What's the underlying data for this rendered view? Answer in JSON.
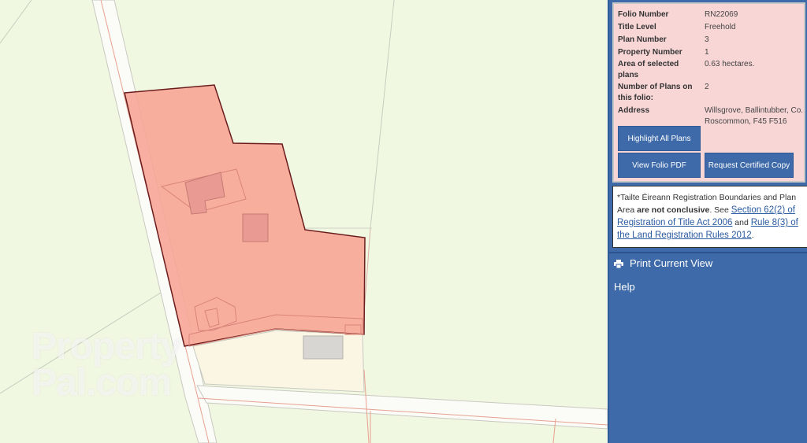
{
  "info": {
    "rows": [
      {
        "label": "Folio Number",
        "value": "RN22069"
      },
      {
        "label": "Title Level",
        "value": "Freehold"
      },
      {
        "label": "Plan Number",
        "value": "3"
      },
      {
        "label": "Property Number",
        "value": "1"
      },
      {
        "label": "Area of selected plans",
        "value": "0.63 hectares."
      },
      {
        "label": "Number of Plans on this folio:",
        "value": "2"
      },
      {
        "label": "Address",
        "value": "Willsgrove, Ballintubber, Co. Roscommon, F45 F516"
      }
    ]
  },
  "buttons": {
    "highlight": "Highlight All Plans",
    "view_pdf": "View Folio PDF",
    "request_copy": "Request Certified Copy"
  },
  "notice": {
    "prefix": "*Tailte Éireann Registration Boundaries and Plan Area ",
    "bold": "are not conclusive",
    "mid": ". See ",
    "link1": "Section 62(2) of Registration of Title Act 2006",
    "and": " and ",
    "link2": "Rule 8(3) of the Land Registration Rules 2012",
    "end": "."
  },
  "menu": {
    "print": "Print Current View",
    "help": "Help"
  },
  "watermark": {
    "line1": "Property",
    "line2": "Pal.com"
  },
  "colors": {
    "map_bg": "#f1f8e2",
    "parcel_fill": "#f7a596",
    "parcel_stroke": "#6b1c1c",
    "panel_bg": "#3e6aa9",
    "info_bg": "#f8d6d6"
  }
}
